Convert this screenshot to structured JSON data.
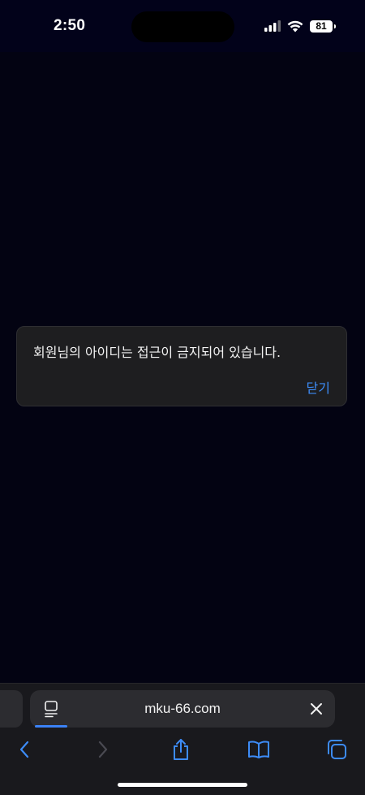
{
  "status_bar": {
    "time": "2:50",
    "battery": "81"
  },
  "dialog": {
    "message": "회원님의 아이디는 접근이 금지되어 있습니다.",
    "close_label": "닫기"
  },
  "browser": {
    "url": "mku-66.com"
  },
  "colors": {
    "accent": "#3d8cf7",
    "background": "#030312",
    "dialog_bg": "#1e1e20",
    "toolbar_bg": "#19191d"
  },
  "icons": {
    "signal": "cellular-signal-icon",
    "wifi": "wifi-icon",
    "page": "page-menu-icon",
    "clear": "close-icon",
    "back": "chevron-left-icon",
    "forward": "chevron-right-icon",
    "share": "share-icon",
    "bookmarks": "book-icon",
    "tabs": "tabs-icon"
  }
}
